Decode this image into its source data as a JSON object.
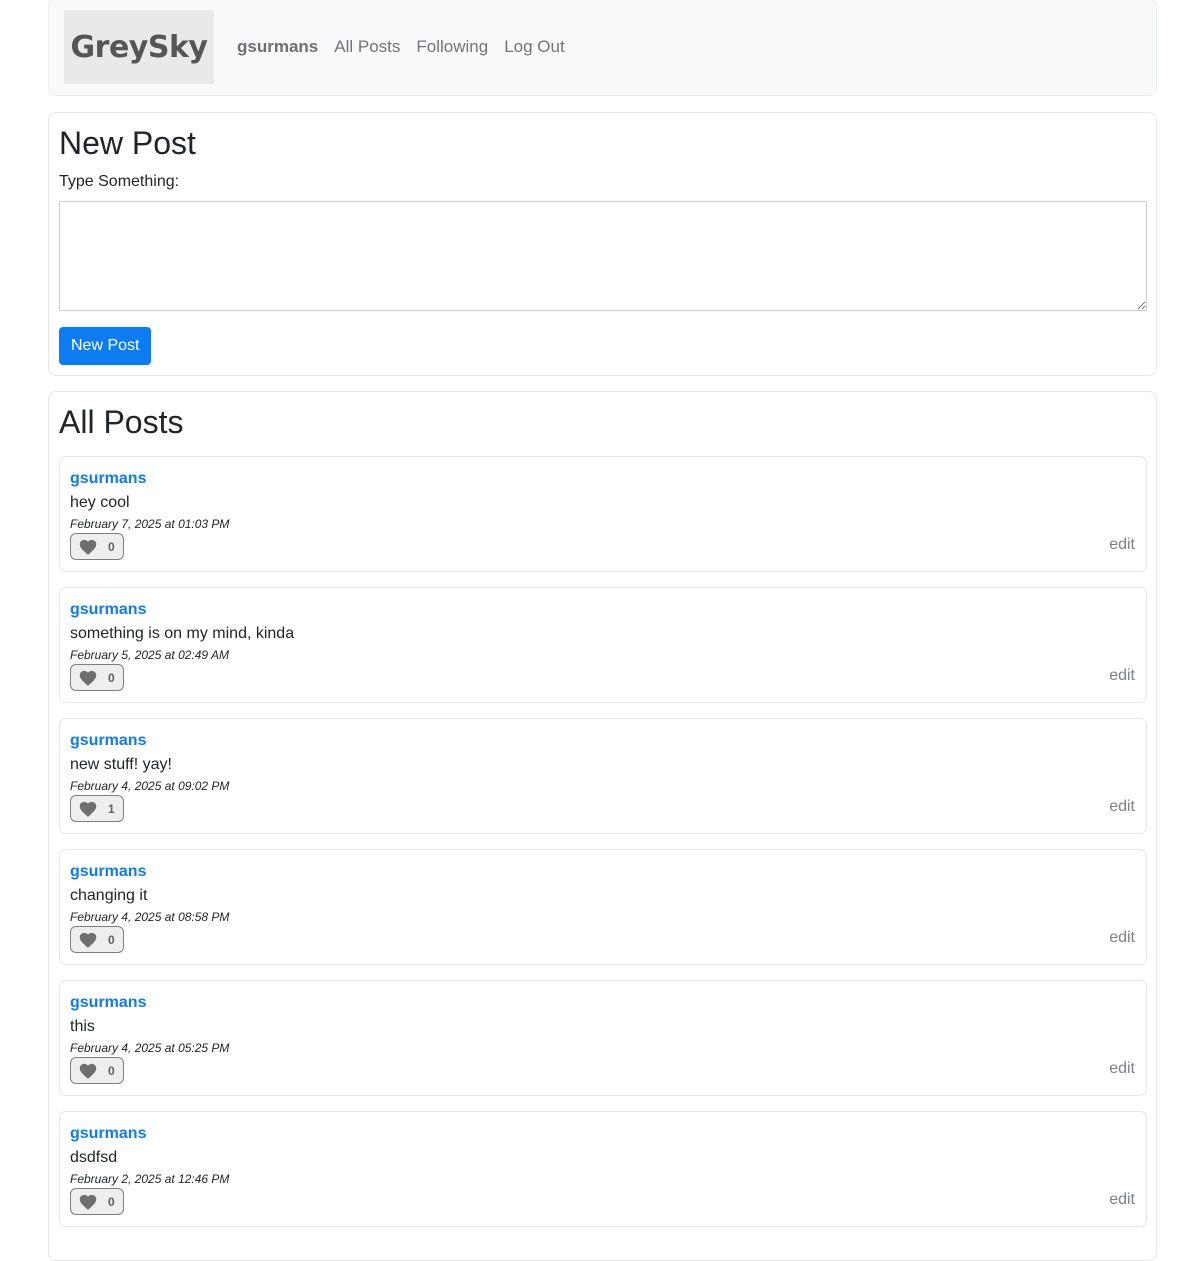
{
  "nav": {
    "logo": "GreySky",
    "username": "gsurmans",
    "all_posts": "All Posts",
    "following": "Following",
    "log_out": "Log Out"
  },
  "new_post": {
    "title": "New Post",
    "label": "Type Something:",
    "input_value": "",
    "button": "New Post"
  },
  "all_posts": {
    "title": "All Posts"
  },
  "posts": [
    {
      "author": "gsurmans",
      "body": "hey cool",
      "time": "February 7, 2025 at 01:03 PM",
      "likes": "0",
      "edit": "edit"
    },
    {
      "author": "gsurmans",
      "body": "something is on my mind, kinda",
      "time": "February 5, 2025 at 02:49 AM",
      "likes": "0",
      "edit": "edit"
    },
    {
      "author": "gsurmans",
      "body": "new stuff! yay!",
      "time": "February 4, 2025 at 09:02 PM",
      "likes": "1",
      "edit": "edit"
    },
    {
      "author": "gsurmans",
      "body": "changing it",
      "time": "February 4, 2025 at 08:58 PM",
      "likes": "0",
      "edit": "edit"
    },
    {
      "author": "gsurmans",
      "body": "this",
      "time": "February 4, 2025 at 05:25 PM",
      "likes": "0",
      "edit": "edit"
    },
    {
      "author": "gsurmans",
      "body": "dsdfsd",
      "time": "February 2, 2025 at 12:46 PM",
      "likes": "0",
      "edit": "edit"
    }
  ],
  "icons": {
    "like": "heart-icon"
  },
  "colors": {
    "accent": "#0d7cf2",
    "navbar_bg": "#f8f9fa",
    "heart": "#6e6e6e"
  }
}
